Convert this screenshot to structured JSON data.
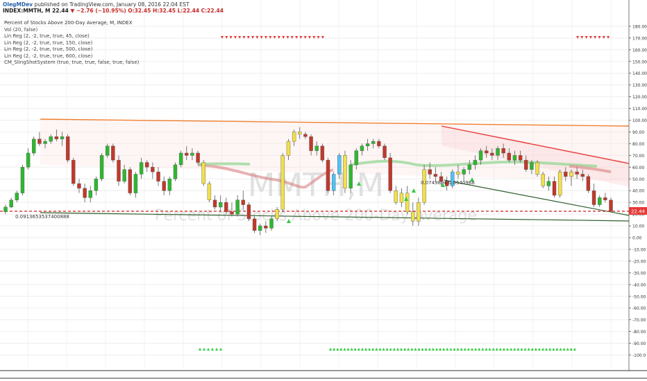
{
  "header": {
    "user": "OlegMDev",
    "published_text": "published on TradingView.com, January 08, 2016 22:04 EST",
    "symbol_line": "INDEX:MMTH, M",
    "last_price": "22.44",
    "change": "−2.76 (−10.95%)",
    "ohlc": "O:32.45 H:32.45 L:22.44 C:22.44"
  },
  "studies": {
    "title": "Percent of Stocks Above 200-Day Average, M, INDEX",
    "items": [
      "Vol (20, false)",
      "Lin Reg (2, -2, true, true, 45, close)",
      "Lin Reg (2, -2, true, true, 150, close)",
      "Lin Reg (2, -2, true, true, 500, close)",
      "Lin Reg (2, -2, true, true, 600, close)",
      "CM_SlingShotSystem (true, true, true, false, true, false)"
    ]
  },
  "watermark": {
    "symbol": "MMTH,M",
    "name": "Percent of Stocks Above 200-Day Average"
  },
  "annotations": {
    "left_value": "0.0913653537400888",
    "mid_value": "0.0749894",
    "mid_value2": "0.0540968"
  },
  "price_label": "22.44",
  "colors": {
    "up": "#2eb82e",
    "down": "#c0392b",
    "yellow": "#f1e04a",
    "cyan": "#4fc3f7",
    "orange_line": "#f07f2e",
    "red_line": "#e53935",
    "green_line": "#2e5e2e",
    "dashed": "#d32f2f",
    "label_bg": "#e53935",
    "triangle_down": "#e53935",
    "triangle_up": "#2ecc40"
  },
  "chart_data": {
    "type": "candlestick",
    "title": "Percent of Stocks Above 200-Day Average, M, INDEX",
    "y_axis": {
      "ylim": [
        -105,
        185
      ],
      "ticks": [
        180,
        170,
        160,
        150,
        140,
        130,
        120,
        110,
        100,
        90,
        80,
        70,
        60,
        50,
        40,
        30,
        20,
        10,
        0,
        -10,
        -20,
        -30,
        -40,
        -50,
        -60,
        -70,
        -80,
        -90,
        -100
      ],
      "tick_labels": [
        "180.00",
        "170.00",
        "160.00",
        "150.00",
        "140.00",
        "130.00",
        "120.00",
        "110.00",
        "100.00",
        "90.00",
        "80.00",
        "70.00",
        "60.00",
        "50.00",
        "40.00",
        "30.00",
        "20.00",
        "10.00",
        "0.00",
        "-10.00",
        "-20.00",
        "-30.00",
        "-40.00",
        "-50.00",
        "-60.00",
        "-70.00",
        "-80.00",
        "-90.00",
        "-100.0"
      ]
    },
    "last_close": 22.44,
    "candles": [
      [
        22,
        28,
        20,
        26,
        "g"
      ],
      [
        26,
        34,
        25,
        32,
        "g"
      ],
      [
        32,
        40,
        30,
        38,
        "g"
      ],
      [
        38,
        62,
        36,
        60,
        "g"
      ],
      [
        60,
        76,
        58,
        72,
        "g"
      ],
      [
        72,
        86,
        70,
        84,
        "g"
      ],
      [
        84,
        90,
        78,
        80,
        "r"
      ],
      [
        80,
        84,
        76,
        82,
        "g"
      ],
      [
        82,
        88,
        80,
        86,
        "g"
      ],
      [
        86,
        92,
        82,
        84,
        "r"
      ],
      [
        84,
        90,
        78,
        86,
        "g"
      ],
      [
        86,
        88,
        64,
        66,
        "r"
      ],
      [
        66,
        68,
        44,
        46,
        "r"
      ],
      [
        46,
        50,
        38,
        42,
        "r"
      ],
      [
        42,
        46,
        30,
        34,
        "r"
      ],
      [
        34,
        44,
        30,
        40,
        "g"
      ],
      [
        40,
        52,
        36,
        50,
        "g"
      ],
      [
        50,
        72,
        48,
        70,
        "g"
      ],
      [
        70,
        80,
        68,
        78,
        "g"
      ],
      [
        78,
        80,
        64,
        66,
        "r"
      ],
      [
        66,
        70,
        44,
        48,
        "r"
      ],
      [
        48,
        62,
        46,
        58,
        "g"
      ],
      [
        58,
        60,
        36,
        38,
        "r"
      ],
      [
        38,
        56,
        34,
        54,
        "g"
      ],
      [
        54,
        68,
        50,
        64,
        "g"
      ],
      [
        64,
        66,
        56,
        60,
        "r"
      ],
      [
        60,
        64,
        50,
        56,
        "r"
      ],
      [
        56,
        60,
        44,
        48,
        "r"
      ],
      [
        48,
        52,
        36,
        40,
        "r"
      ],
      [
        40,
        52,
        36,
        50,
        "g"
      ],
      [
        50,
        64,
        48,
        62,
        "g"
      ],
      [
        62,
        74,
        60,
        72,
        "g"
      ],
      [
        72,
        78,
        66,
        70,
        "r"
      ],
      [
        70,
        76,
        66,
        72,
        "g"
      ],
      [
        72,
        74,
        62,
        64,
        "r"
      ],
      [
        64,
        66,
        44,
        46,
        "y"
      ],
      [
        46,
        48,
        30,
        32,
        "y"
      ],
      [
        32,
        36,
        24,
        26,
        "r"
      ],
      [
        26,
        36,
        22,
        30,
        "g"
      ],
      [
        30,
        34,
        20,
        22,
        "r"
      ],
      [
        22,
        30,
        18,
        20,
        "r"
      ],
      [
        20,
        36,
        18,
        32,
        "g"
      ],
      [
        32,
        40,
        24,
        28,
        "r"
      ],
      [
        28,
        30,
        14,
        16,
        "r"
      ],
      [
        16,
        18,
        4,
        6,
        "r"
      ],
      [
        6,
        12,
        2,
        10,
        "g"
      ],
      [
        10,
        14,
        4,
        8,
        "r"
      ],
      [
        8,
        18,
        6,
        16,
        "g"
      ],
      [
        16,
        26,
        14,
        24,
        "y"
      ],
      [
        24,
        72,
        22,
        70,
        "y"
      ],
      [
        70,
        84,
        66,
        82,
        "y"
      ],
      [
        82,
        92,
        78,
        90,
        "y"
      ],
      [
        90,
        94,
        84,
        88,
        "y"
      ],
      [
        88,
        90,
        84,
        86,
        "r"
      ],
      [
        86,
        88,
        70,
        74,
        "r"
      ],
      [
        74,
        82,
        70,
        78,
        "g"
      ],
      [
        78,
        80,
        64,
        66,
        "r"
      ],
      [
        66,
        68,
        38,
        40,
        "r"
      ],
      [
        40,
        56,
        36,
        54,
        "c"
      ],
      [
        54,
        72,
        50,
        70,
        "c"
      ],
      [
        70,
        74,
        38,
        42,
        "y"
      ],
      [
        42,
        66,
        38,
        62,
        "g"
      ],
      [
        62,
        76,
        58,
        74,
        "g"
      ],
      [
        74,
        80,
        70,
        78,
        "g"
      ],
      [
        78,
        84,
        74,
        80,
        "g"
      ],
      [
        80,
        84,
        76,
        82,
        "g"
      ],
      [
        82,
        84,
        76,
        78,
        "r"
      ],
      [
        78,
        80,
        66,
        68,
        "r"
      ],
      [
        68,
        72,
        38,
        40,
        "r"
      ],
      [
        40,
        44,
        28,
        30,
        "y"
      ],
      [
        30,
        42,
        26,
        38,
        "y"
      ],
      [
        38,
        44,
        20,
        22,
        "y"
      ],
      [
        22,
        30,
        10,
        14,
        "y"
      ],
      [
        14,
        34,
        10,
        30,
        "y"
      ],
      [
        30,
        62,
        28,
        58,
        "y"
      ],
      [
        58,
        64,
        50,
        54,
        "r"
      ],
      [
        54,
        60,
        48,
        52,
        "r"
      ],
      [
        52,
        56,
        44,
        48,
        "r"
      ],
      [
        48,
        52,
        40,
        44,
        "r"
      ],
      [
        44,
        58,
        42,
        56,
        "c"
      ],
      [
        56,
        62,
        50,
        54,
        "y"
      ],
      [
        54,
        60,
        48,
        58,
        "g"
      ],
      [
        58,
        66,
        54,
        62,
        "g"
      ],
      [
        62,
        70,
        58,
        66,
        "g"
      ],
      [
        66,
        76,
        62,
        74,
        "g"
      ],
      [
        74,
        78,
        68,
        72,
        "r"
      ],
      [
        72,
        76,
        66,
        70,
        "r"
      ],
      [
        70,
        78,
        66,
        76,
        "g"
      ],
      [
        76,
        80,
        68,
        72,
        "r"
      ],
      [
        72,
        76,
        64,
        66,
        "r"
      ],
      [
        66,
        74,
        62,
        70,
        "g"
      ],
      [
        70,
        74,
        64,
        66,
        "r"
      ],
      [
        66,
        70,
        56,
        58,
        "r"
      ],
      [
        58,
        66,
        54,
        64,
        "g"
      ],
      [
        64,
        66,
        52,
        54,
        "y"
      ],
      [
        54,
        56,
        42,
        44,
        "y"
      ],
      [
        44,
        52,
        40,
        48,
        "g"
      ],
      [
        48,
        52,
        34,
        36,
        "r"
      ],
      [
        36,
        58,
        34,
        56,
        "y"
      ],
      [
        56,
        60,
        48,
        52,
        "r"
      ],
      [
        52,
        58,
        44,
        56,
        "y"
      ],
      [
        56,
        60,
        50,
        54,
        "r"
      ],
      [
        54,
        58,
        48,
        52,
        "r"
      ],
      [
        52,
        54,
        38,
        40,
        "r"
      ],
      [
        40,
        46,
        26,
        28,
        "r"
      ],
      [
        28,
        36,
        26,
        34,
        "g"
      ],
      [
        34,
        38,
        30,
        32,
        "r"
      ],
      [
        32,
        34,
        22,
        22.44,
        "r"
      ]
    ]
  }
}
